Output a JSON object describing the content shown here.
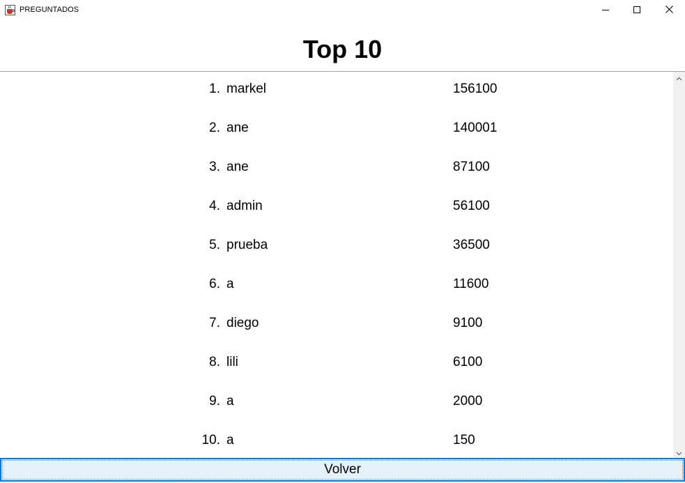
{
  "window": {
    "title": "PREGUNTADOS",
    "icon": "java-cup-icon"
  },
  "heading": "Top 10",
  "ranking": [
    {
      "rank": "1.",
      "name": "markel",
      "score": "156100"
    },
    {
      "rank": "2.",
      "name": "ane",
      "score": "140001"
    },
    {
      "rank": "3.",
      "name": "ane",
      "score": "87100"
    },
    {
      "rank": "4.",
      "name": "admin",
      "score": "56100"
    },
    {
      "rank": "5.",
      "name": "prueba",
      "score": "36500"
    },
    {
      "rank": "6.",
      "name": "a",
      "score": "11600"
    },
    {
      "rank": "7.",
      "name": "diego",
      "score": "9100"
    },
    {
      "rank": "8.",
      "name": "lili",
      "score": "6100"
    },
    {
      "rank": "9.",
      "name": "a",
      "score": "2000"
    },
    {
      "rank": "10.",
      "name": "a",
      "score": "150"
    }
  ],
  "back_button": {
    "label": "Volver"
  },
  "colors": {
    "accent": "#0078d7",
    "button_bg": "#e5f1fb",
    "scrollbar_bg": "#f0f0f0"
  }
}
